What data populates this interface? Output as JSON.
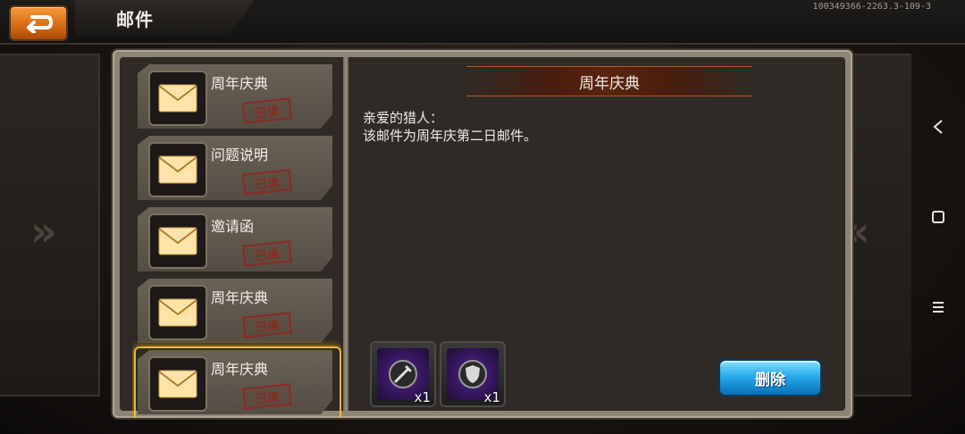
{
  "header": {
    "title": "邮件",
    "build_id": "100349366-2263.3-109-3"
  },
  "mail_list": [
    {
      "title": "周年庆典",
      "status": "已读",
      "selected": false
    },
    {
      "title": "问题说明",
      "status": "已读",
      "selected": false
    },
    {
      "title": "邀请函",
      "status": "已读",
      "selected": false
    },
    {
      "title": "周年庆典",
      "status": "已读",
      "selected": false
    },
    {
      "title": "周年庆典",
      "status": "已读",
      "selected": true
    }
  ],
  "detail": {
    "title": "周年庆典",
    "greeting": "亲爱的猎人：",
    "body": "该邮件为周年庆第二日邮件。",
    "rewards": [
      {
        "icon": "sword-gem-icon",
        "qty": "x1"
      },
      {
        "icon": "shield-gem-icon",
        "qty": "x1"
      }
    ],
    "delete_label": "删除"
  },
  "colors": {
    "accent_orange": "#d66a12",
    "selected_gold": "#e8b73c",
    "delete_blue": "#23a5e8",
    "stamp_red": "#8b2a22"
  }
}
